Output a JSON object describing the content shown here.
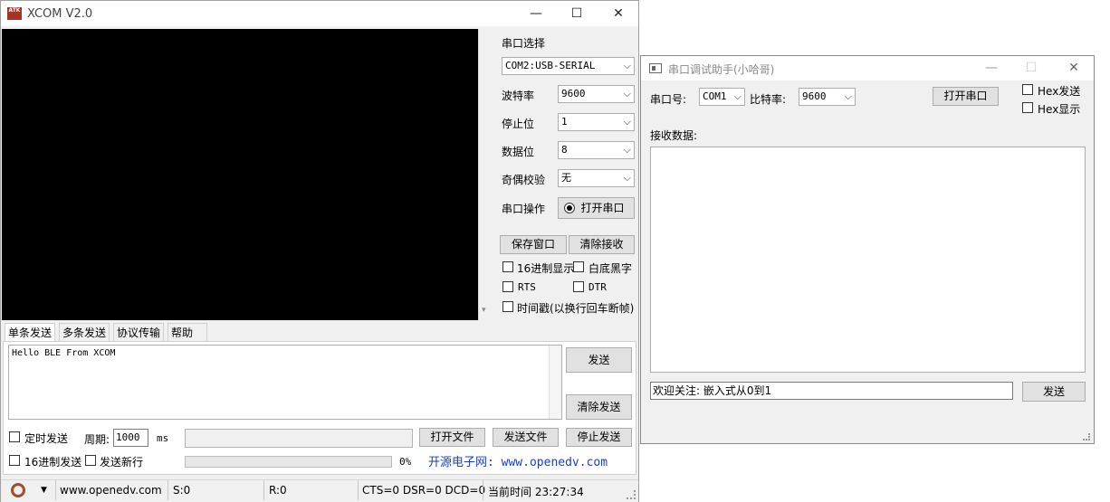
{
  "xcom": {
    "title": "XCOM V2.0",
    "logo_text": "ATK",
    "window_controls": {
      "minimize": "—",
      "maximize": "☐",
      "close": "✕"
    },
    "serial_select_label": "串口选择",
    "port_value": "COM2:USB-SERIAL",
    "baud_label": "波特率",
    "baud_value": "9600",
    "stopbit_label": "停止位",
    "stopbit_value": "1",
    "databit_label": "数据位",
    "databit_value": "8",
    "parity_label": "奇偶校验",
    "parity_value": "无",
    "serial_op_label": "串口操作",
    "open_port_label": "打开串口",
    "save_window_label": "保存窗口",
    "clear_recv_label": "清除接收",
    "hex_display_label": "16进制显示",
    "white_black_label": "白底黑字",
    "rts_label": "RTS",
    "dtr_label": "DTR",
    "timestamp_label": "时间戳(以换行回车断帧)",
    "tabs": [
      "单条发送",
      "多条发送",
      "协议传输",
      "帮助"
    ],
    "send_text": "Hello BLE From XCOM",
    "send_label": "发送",
    "clear_send_label": "清除发送",
    "timed_send_label": "定时发送",
    "period_label": "周期:",
    "period_value": "1000",
    "ms_label": "ms",
    "open_file_label": "打开文件",
    "send_file_label": "发送文件",
    "stop_send_label": "停止发送",
    "hex_send_label": "16进制发送",
    "send_newline_label": "发送新行",
    "progress_text": "0%",
    "progress_value": 0,
    "promo_text": "开源电子网: www.openedv.com",
    "status": {
      "url": "www.openedv.com",
      "s": "S:0",
      "r": "R:0",
      "lines": "CTS=0 DSR=0 DCD=0",
      "time": "当前时间 23:27:34"
    }
  },
  "helper": {
    "title": "串口调试助手(小哈哥)",
    "window_controls": {
      "minimize": "—",
      "maximize": "☐",
      "close": "✕"
    },
    "port_label": "串口号:",
    "port_value": "COM1",
    "baud_label": "比特率:",
    "baud_value": "9600",
    "open_port_label": "打开串口",
    "hex_send_label": "Hex发送",
    "hex_display_label": "Hex显示",
    "recv_label": "接收数据:",
    "send_input_value": "欢迎关注: 嵌入式从0到1",
    "send_label": "发送"
  }
}
